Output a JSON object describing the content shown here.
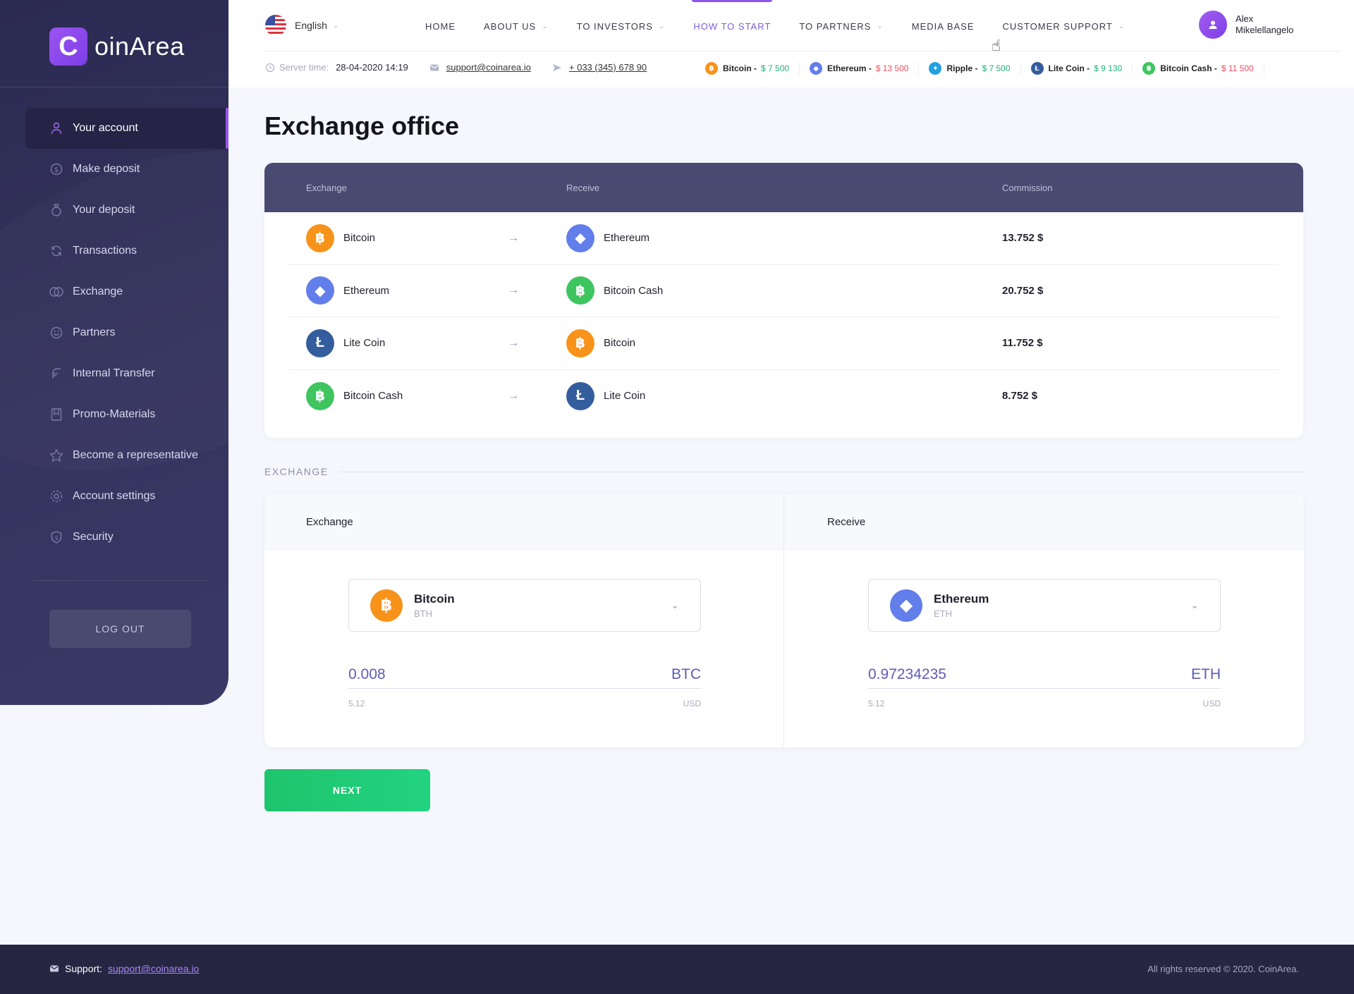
{
  "brand": {
    "logo_letter": "C",
    "logo_text": "oinArea"
  },
  "sidebar": {
    "items": [
      {
        "label": "Your account",
        "icon": "user-icon",
        "active": true
      },
      {
        "label": "Make deposit",
        "icon": "coin-icon"
      },
      {
        "label": "Your deposit",
        "icon": "bag-icon"
      },
      {
        "label": "Transactions",
        "icon": "refresh-icon"
      },
      {
        "label": "Exchange",
        "icon": "exchange-icon"
      },
      {
        "label": "Partners",
        "icon": "smile-icon"
      },
      {
        "label": "Internal Transfer",
        "icon": "transfer-icon"
      },
      {
        "label": "Promo-Materials",
        "icon": "bookmark-icon"
      },
      {
        "label": "Become a representative",
        "icon": "star-icon"
      },
      {
        "label": "Account settings",
        "icon": "gear-icon"
      },
      {
        "label": "Security",
        "icon": "shield-icon"
      }
    ],
    "logout_label": "LOG OUT"
  },
  "header": {
    "language": "English",
    "nav": [
      {
        "label": "HOME",
        "dropdown": false
      },
      {
        "label": "ABOUT US",
        "dropdown": true
      },
      {
        "label": "TO INVESTORS",
        "dropdown": true
      },
      {
        "label": "HOW TO START",
        "dropdown": false,
        "active": true
      },
      {
        "label": "TO PARTNERS",
        "dropdown": true
      },
      {
        "label": "MEDIA BASE",
        "dropdown": false
      },
      {
        "label": "CUSTOMER SUPPORT",
        "dropdown": true
      }
    ],
    "user_name": "Alex Mikelellangelo",
    "server_time_label": "Server time:",
    "server_time": "28-04-2020 14:19",
    "email": "support@coinarea.io",
    "phone": "+ 033 (345) 678 90",
    "ticker": [
      {
        "name": "Bitcoin -",
        "price": "$ 7 500",
        "trend": "up",
        "coin": "btc"
      },
      {
        "name": "Ethereum -",
        "price": "$ 13 500",
        "trend": "down",
        "coin": "eth"
      },
      {
        "name": "Ripple -",
        "price": "$ 7 500",
        "trend": "up",
        "coin": "xrp"
      },
      {
        "name": "Lite Coin -",
        "price": "$ 9 130",
        "trend": "up",
        "coin": "ltc"
      },
      {
        "name": "Bitcoin Cash -",
        "price": "$ 11 500",
        "trend": "down",
        "coin": "bch"
      }
    ]
  },
  "main": {
    "title": "Exchange office",
    "table": {
      "headers": [
        "Exchange",
        "Receive",
        "Commission"
      ],
      "rows": [
        {
          "from": "Bitcoin",
          "from_coin": "btc",
          "to": "Ethereum",
          "to_coin": "eth",
          "commission": "13.752 $"
        },
        {
          "from": "Ethereum",
          "from_coin": "eth",
          "to": "Bitcoin Cash",
          "to_coin": "bch",
          "commission": "20.752 $"
        },
        {
          "from": "Lite Coin",
          "from_coin": "ltc",
          "to": "Bitcoin",
          "to_coin": "btc",
          "commission": "11.752 $"
        },
        {
          "from": "Bitcoin Cash",
          "from_coin": "bch",
          "to": "Lite Coin",
          "to_coin": "ltc",
          "commission": "8.752 $"
        }
      ]
    },
    "exchange_section_label": "EXCHANGE",
    "exchange_form": {
      "left": {
        "header": "Exchange",
        "coin_name": "Bitcoin",
        "coin_symbol": "BTH",
        "amount": "0.008",
        "unit": "BTC",
        "usd_value": "5.12",
        "usd_label": "USD"
      },
      "right": {
        "header": "Receive",
        "coin_name": "Ethereum",
        "coin_symbol": "ETH",
        "amount": "0.97234235",
        "unit": "ETH",
        "usd_value": "5.12",
        "usd_label": "USD"
      }
    },
    "next_label": "NEXT"
  },
  "footer": {
    "support_label": "Support:",
    "support_email": "support@coinarea.io",
    "copyright": "All rights reserved © 2020. CoinArea."
  }
}
